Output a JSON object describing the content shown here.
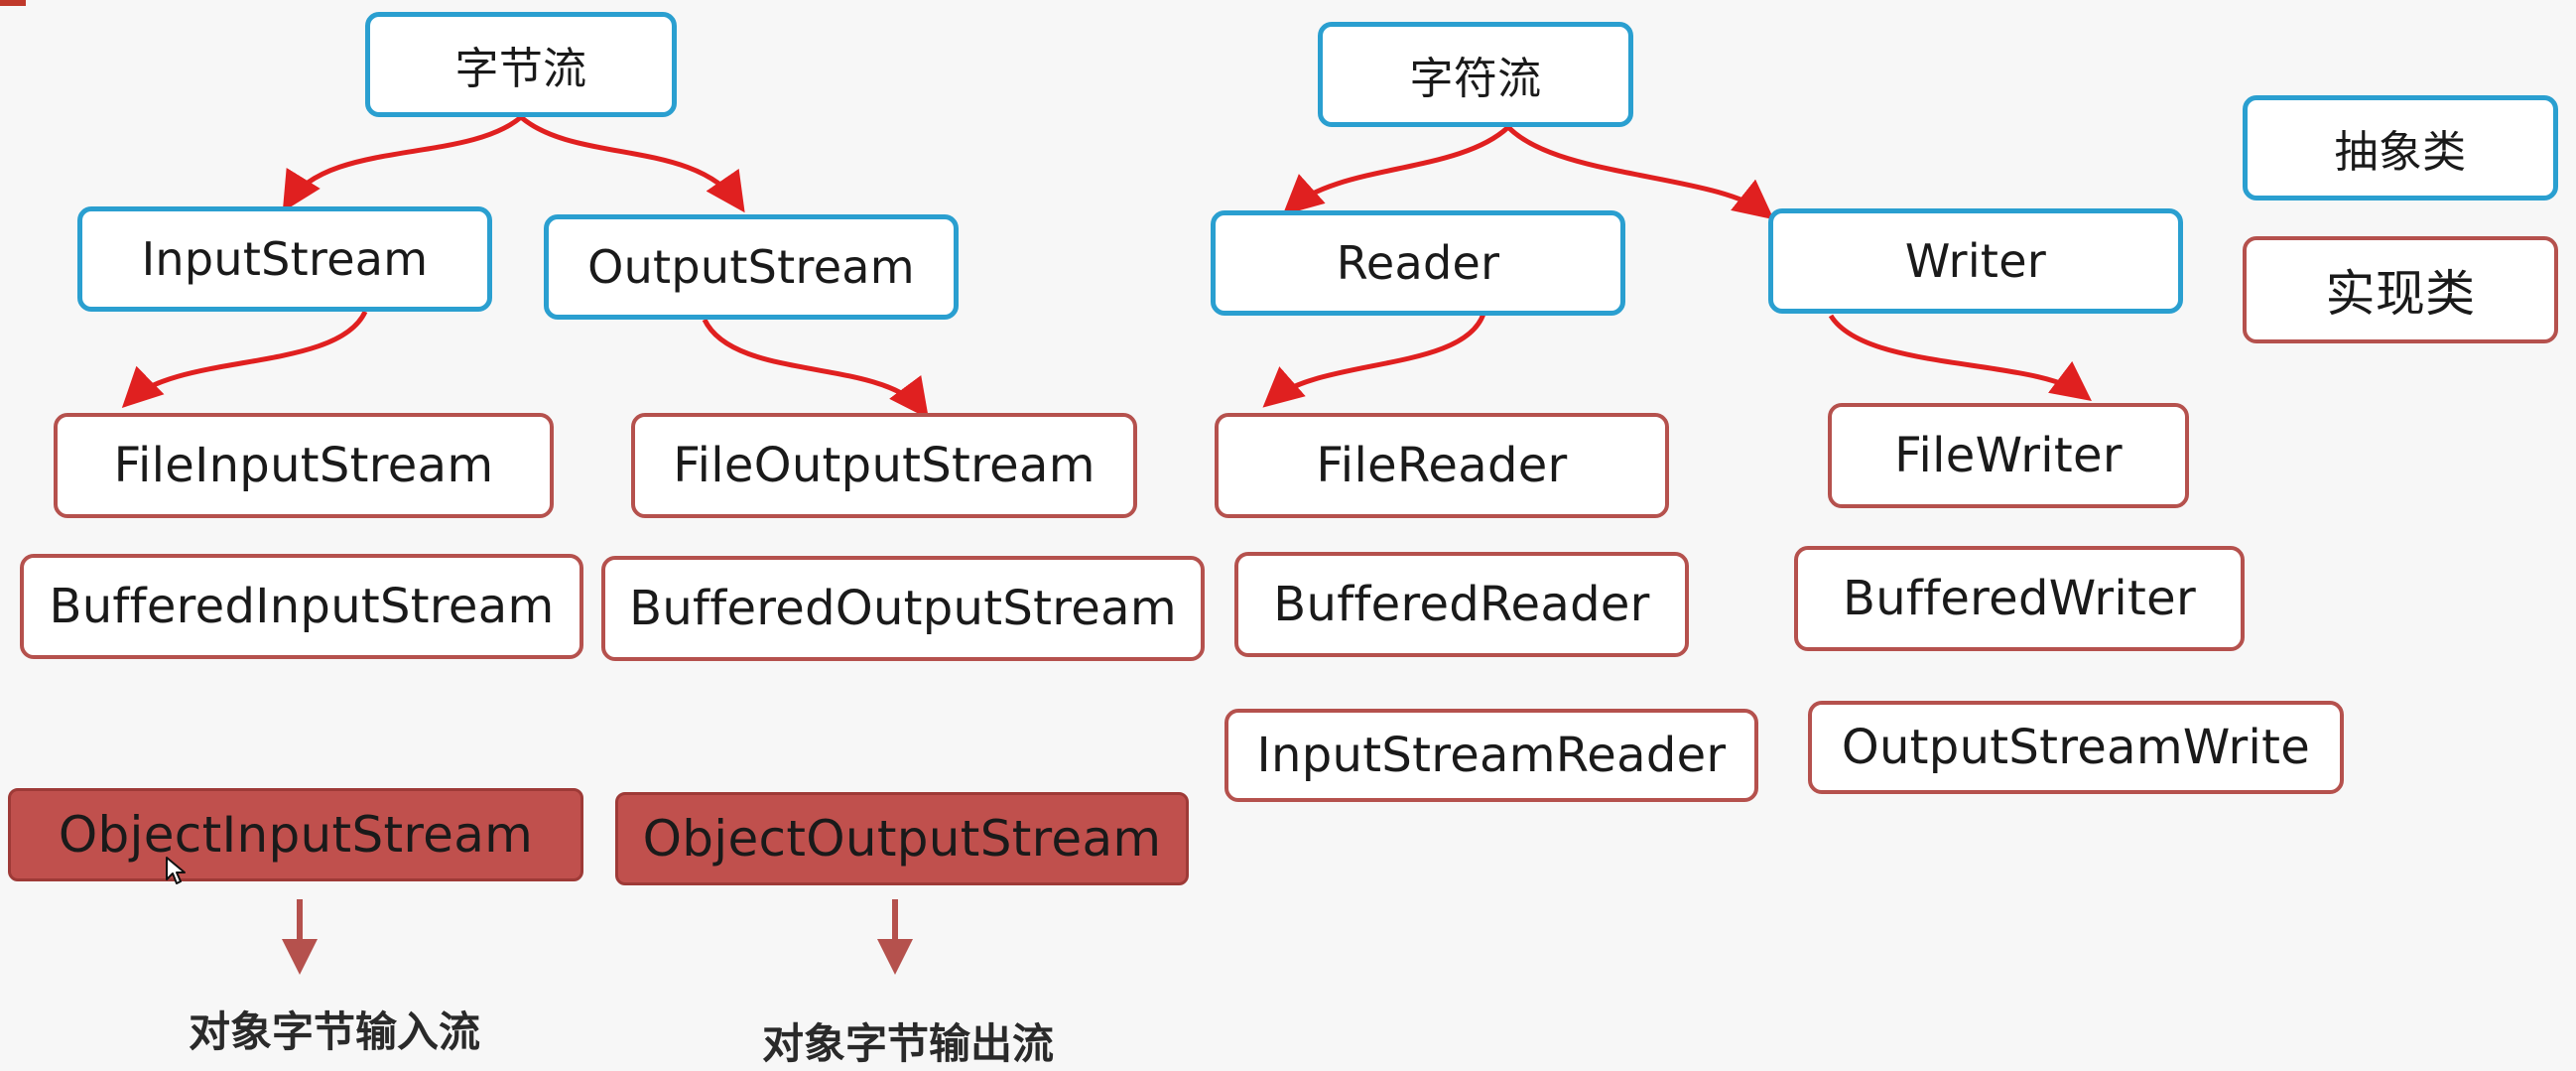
{
  "byte_stream": {
    "root": "字节流",
    "input_stream": "InputStream",
    "output_stream": "OutputStream",
    "file_input_stream": "FileInputStream",
    "buffered_input_stream": "BufferedInputStream",
    "file_output_stream": "FileOutputStream",
    "buffered_output_stream": "BufferedOutputStream",
    "object_input_stream": "ObjectInputStream",
    "object_output_stream": "ObjectOutputStream",
    "object_input_caption": "对象字节输入流",
    "object_output_caption": "对象字节输出流"
  },
  "char_stream": {
    "root": "字符流",
    "reader": "Reader",
    "writer": "Writer",
    "file_reader": "FileReader",
    "buffered_reader": "BufferedReader",
    "input_stream_reader": "InputStreamReader",
    "file_writer": "FileWriter",
    "buffered_writer": "BufferedWriter",
    "output_stream_write": "OutputStreamWrite"
  },
  "legend": {
    "abstract_class": "抽象类",
    "concrete_class": "实现类"
  },
  "colors": {
    "abstract_border": "#2a9fd0",
    "concrete_border": "#b5514d",
    "arrow": "#e02020",
    "highlight_fill": "#c0504d"
  }
}
